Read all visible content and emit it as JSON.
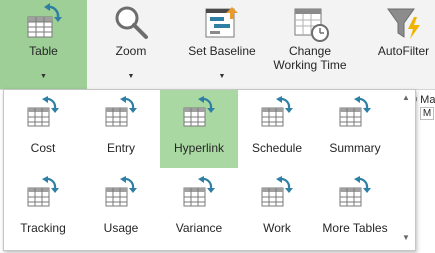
{
  "ribbon": {
    "table_label": "Table",
    "zoom_label": "Zoom",
    "baseline_label": "Set Baseline",
    "working_time_label_line1": "Change",
    "working_time_label_line2": "Working Time",
    "autofilter_label": "AutoFilter",
    "dropdown_arrow": "▼"
  },
  "background": {
    "date_fragment": "9 Ma",
    "day_cell": "M"
  },
  "gallery": {
    "selected": "Hyperlink",
    "row1": [
      {
        "label": "Cost"
      },
      {
        "label": "Entry"
      },
      {
        "label": "Hyperlink"
      },
      {
        "label": "Schedule"
      },
      {
        "label": "Summary"
      }
    ],
    "row2": [
      {
        "label": "Tracking"
      },
      {
        "label": "Usage"
      },
      {
        "label": "Variance"
      },
      {
        "label": "Work"
      },
      {
        "label": "More Tables"
      }
    ],
    "scroll_up": "▲",
    "scroll_down": "▼"
  },
  "colors": {
    "ribbon_bg": "#f3f3f3",
    "selected_bg": "#9dcf96",
    "icon_arrow": "#2e7fa3",
    "filter_bolt": "#f0b400"
  }
}
